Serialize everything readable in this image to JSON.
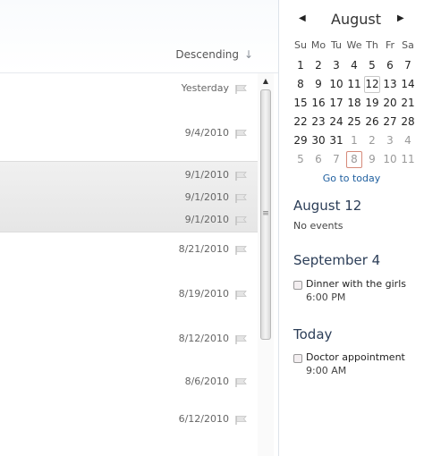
{
  "list": {
    "sort_label": "Descending",
    "sort_icon": "arrow-down-icon",
    "rows": [
      {
        "date": "Yesterday"
      },
      {
        "date": "9/4/2010"
      },
      {
        "date": "9/1/2010"
      },
      {
        "date": "9/1/2010"
      },
      {
        "date": "9/1/2010"
      },
      {
        "date": "8/21/2010"
      },
      {
        "date": "8/19/2010"
      },
      {
        "date": "8/12/2010"
      },
      {
        "date": "8/6/2010"
      },
      {
        "date": "6/12/2010"
      }
    ]
  },
  "calendar": {
    "month": "August",
    "weekdays": [
      "Su",
      "Mo",
      "Tu",
      "We",
      "Th",
      "Fr",
      "Sa"
    ],
    "weeks": [
      [
        "1",
        "2",
        "3",
        "4",
        "5",
        "6",
        "7"
      ],
      [
        "8",
        "9",
        "10",
        "11",
        "12",
        "13",
        "14"
      ],
      [
        "15",
        "16",
        "17",
        "18",
        "19",
        "20",
        "21"
      ],
      [
        "22",
        "23",
        "24",
        "25",
        "26",
        "27",
        "28"
      ],
      [
        "29",
        "30",
        "31",
        "1",
        "2",
        "3",
        "4"
      ],
      [
        "5",
        "6",
        "7",
        "8",
        "9",
        "10",
        "11"
      ]
    ],
    "go_to_today": "Go to today"
  },
  "agenda": {
    "day1_title": "August 12",
    "day1_note": "No events",
    "day2_title": "September 4",
    "day2_event_name": "Dinner with the girls",
    "day2_event_time": "6:00 PM",
    "day3_title": "Today",
    "day3_event_name": "Doctor appointment",
    "day3_event_time": "9:00 AM"
  },
  "colors": {
    "accent_link": "#1f5f9f",
    "today_outline": "#d68a7a",
    "selection_bg": "#e9e9e9"
  }
}
